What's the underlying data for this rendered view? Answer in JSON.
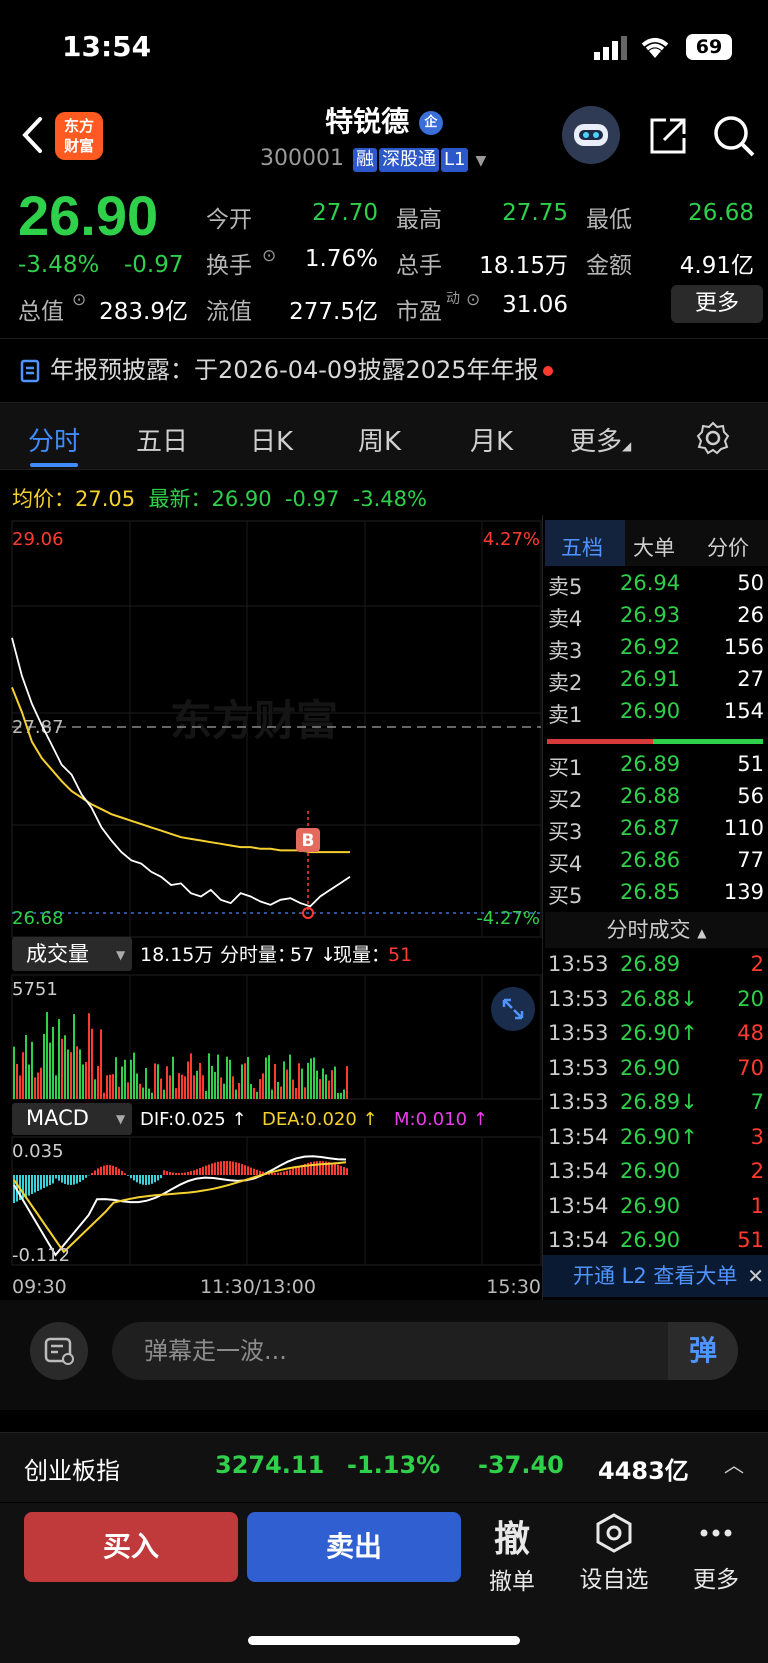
{
  "status_bar": {
    "time": "13:54",
    "battery": "69"
  },
  "header": {
    "logo_line1": "东方",
    "logo_line2": "财富",
    "title": "特锐德",
    "title_badge": "企",
    "code": "300001",
    "tags": [
      "融",
      "深股通",
      "L1"
    ]
  },
  "quote": {
    "price": "26.90",
    "change_pct": "-3.48%",
    "change": "-0.97",
    "fields": [
      {
        "label": "今开",
        "value": "27.70",
        "color": "#2fd04a"
      },
      {
        "label": "最高",
        "value": "27.75",
        "color": "#2fd04a"
      },
      {
        "label": "最低",
        "value": "26.68",
        "color": "#2fd04a"
      },
      {
        "label": "换手",
        "value": "1.76%",
        "color": "#ffffff"
      },
      {
        "label": "总手",
        "value": "18.15万",
        "color": "#ffffff"
      },
      {
        "label": "金额",
        "value": "4.91亿",
        "color": "#ffffff"
      },
      {
        "label": "总值",
        "value": "283.9亿",
        "color": "#ffffff"
      },
      {
        "label": "流值",
        "value": "277.5亿",
        "color": "#ffffff"
      },
      {
        "label": "市盈",
        "value": "31.06",
        "color": "#ffffff"
      }
    ],
    "pe_superscript": "动",
    "more_label": "更多"
  },
  "notice": {
    "text": "年报预披露：于2026-04-09披露2025年年报"
  },
  "tabs": [
    "分时",
    "五日",
    "日K",
    "周K",
    "月K",
    "更多"
  ],
  "chart_info": {
    "avg_label": "均价：",
    "avg_value": "27.05",
    "latest_label": "最新：",
    "latest_value": "26.90",
    "latest_change": "-0.97",
    "latest_pct": "-3.48%"
  },
  "chart_data": {
    "type": "line",
    "y_top": "29.06",
    "y_mid": "27.87",
    "y_bottom": "26.68",
    "pct_top": "4.27%",
    "pct_bottom": "-4.27%",
    "ylim": [
      26.68,
      29.06
    ],
    "prev_close": 27.87,
    "marker": "B",
    "watermark": "东方财富",
    "price_series": [
      28.35,
      28.12,
      27.95,
      27.82,
      27.7,
      27.58,
      27.52,
      27.4,
      27.32,
      27.2,
      27.12,
      27.05,
      27.0,
      26.98,
      26.93,
      26.9,
      26.85,
      26.86,
      26.8,
      26.78,
      26.82,
      26.76,
      26.74,
      26.8,
      26.78,
      26.75,
      26.73,
      26.76,
      26.77,
      26.74,
      26.72,
      26.78,
      26.82,
      26.86,
      26.9
    ],
    "avg_series": [
      28.05,
      27.9,
      27.72,
      27.62,
      27.55,
      27.48,
      27.42,
      27.38,
      27.34,
      27.31,
      27.28,
      27.26,
      27.24,
      27.22,
      27.2,
      27.18,
      27.16,
      27.14,
      27.13,
      27.12,
      27.11,
      27.1,
      27.09,
      27.08,
      27.08,
      27.07,
      27.07,
      27.06,
      27.06,
      27.06,
      27.05,
      27.05,
      27.05,
      27.05,
      27.05
    ],
    "volume": {
      "label": "成交量",
      "total": "18.15万",
      "minute_label": "分时量：",
      "minute_value": "57 ↓",
      "current_label": "现量：",
      "current_value": "51",
      "max": "5751"
    },
    "macd": {
      "label": "MACD",
      "dif": "DIF:0.025 ↑",
      "dea": "DEA:0.020 ↑",
      "m": "M:0.010 ↑",
      "top": "0.035",
      "bottom": "-0.112"
    },
    "x_labels": [
      "09:30",
      "11:30/13:00",
      "15:30"
    ]
  },
  "order_book": {
    "tabs": [
      "五档",
      "大单",
      "分价"
    ],
    "asks": [
      {
        "label": "卖5",
        "price": "26.94",
        "vol": "50"
      },
      {
        "label": "卖4",
        "price": "26.93",
        "vol": "26"
      },
      {
        "label": "卖3",
        "price": "26.92",
        "vol": "156"
      },
      {
        "label": "卖2",
        "price": "26.91",
        "vol": "27"
      },
      {
        "label": "卖1",
        "price": "26.90",
        "vol": "154"
      }
    ],
    "bids": [
      {
        "label": "买1",
        "price": "26.89",
        "vol": "51"
      },
      {
        "label": "买2",
        "price": "26.88",
        "vol": "56"
      },
      {
        "label": "买3",
        "price": "26.87",
        "vol": "110"
      },
      {
        "label": "买4",
        "price": "26.86",
        "vol": "77"
      },
      {
        "label": "买5",
        "price": "26.85",
        "vol": "139"
      }
    ]
  },
  "trades": {
    "title": "分时成交",
    "rows": [
      {
        "time": "13:53",
        "price": "26.89",
        "vol": "2",
        "dir": "",
        "pc": "#2fd04a",
        "vc": "#ff3b30"
      },
      {
        "time": "13:53",
        "price": "26.88↓",
        "vol": "20",
        "dir": "",
        "pc": "#2fd04a",
        "vc": "#2fd04a"
      },
      {
        "time": "13:53",
        "price": "26.90↑",
        "vol": "48",
        "dir": "",
        "pc": "#2fd04a",
        "vc": "#ff3b30"
      },
      {
        "time": "13:53",
        "price": "26.90",
        "vol": "70",
        "dir": "",
        "pc": "#2fd04a",
        "vc": "#ff3b30"
      },
      {
        "time": "13:53",
        "price": "26.89↓",
        "vol": "7",
        "dir": "",
        "pc": "#2fd04a",
        "vc": "#2fd04a"
      },
      {
        "time": "13:54",
        "price": "26.90↑",
        "vol": "3",
        "dir": "",
        "pc": "#2fd04a",
        "vc": "#ff3b30"
      },
      {
        "time": "13:54",
        "price": "26.90",
        "vol": "2",
        "dir": "",
        "pc": "#2fd04a",
        "vc": "#ff3b30"
      },
      {
        "time": "13:54",
        "price": "26.90",
        "vol": "1",
        "dir": "",
        "pc": "#2fd04a",
        "vc": "#ff3b30"
      },
      {
        "time": "13:54",
        "price": "26.90",
        "vol": "51",
        "dir": "",
        "pc": "#2fd04a",
        "vc": "#ff3b30"
      }
    ],
    "l2_text": "开通 L2 查看大单"
  },
  "danmaku": {
    "placeholder": "弹幕走一波...",
    "button": "弹"
  },
  "index_bar": {
    "name": "创业板指",
    "value": "3274.11",
    "pct": "-1.13%",
    "change": "-37.40",
    "amount": "4483亿"
  },
  "actions": {
    "buy": "买入",
    "sell": "卖出",
    "cancel_glyph": "撤",
    "cancel": "撤单",
    "watch": "设自选",
    "more": "更多"
  }
}
